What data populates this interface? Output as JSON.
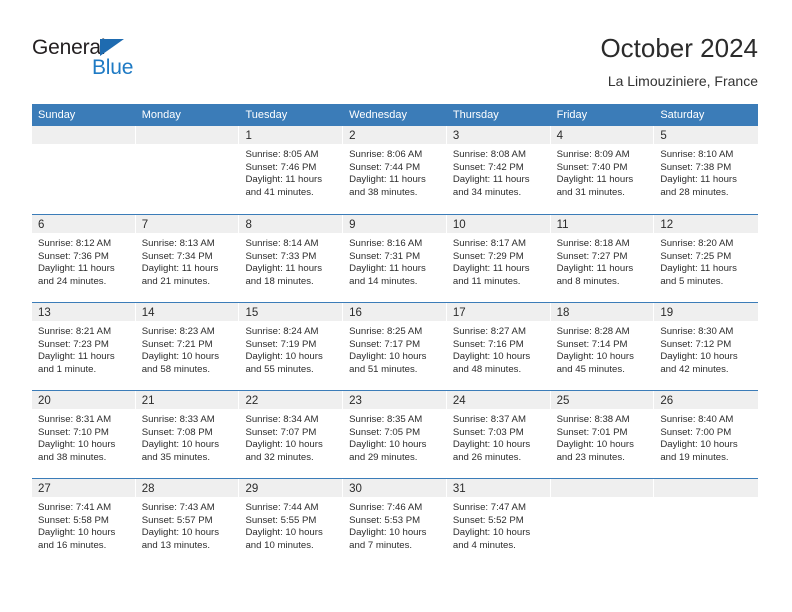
{
  "brand": {
    "name_part1": "General",
    "name_part2": "Blue",
    "color_dark": "#231f20",
    "color_blue": "#1e7ac4"
  },
  "header": {
    "title": "October 2024",
    "subtitle": "La Limouziniere, France"
  },
  "theme": {
    "header_blue": "#3b7cb8",
    "day_band_gray": "#efefef",
    "text": "#2d2d2d"
  },
  "weekday_headers": [
    "Sunday",
    "Monday",
    "Tuesday",
    "Wednesday",
    "Thursday",
    "Friday",
    "Saturday"
  ],
  "weeks": [
    {
      "days": [
        {
          "date": "",
          "sunrise": "",
          "sunset": "",
          "daylight1": "",
          "daylight2": ""
        },
        {
          "date": "",
          "sunrise": "",
          "sunset": "",
          "daylight1": "",
          "daylight2": ""
        },
        {
          "date": "1",
          "sunrise": "Sunrise: 8:05 AM",
          "sunset": "Sunset: 7:46 PM",
          "daylight1": "Daylight: 11 hours",
          "daylight2": "and 41 minutes."
        },
        {
          "date": "2",
          "sunrise": "Sunrise: 8:06 AM",
          "sunset": "Sunset: 7:44 PM",
          "daylight1": "Daylight: 11 hours",
          "daylight2": "and 38 minutes."
        },
        {
          "date": "3",
          "sunrise": "Sunrise: 8:08 AM",
          "sunset": "Sunset: 7:42 PM",
          "daylight1": "Daylight: 11 hours",
          "daylight2": "and 34 minutes."
        },
        {
          "date": "4",
          "sunrise": "Sunrise: 8:09 AM",
          "sunset": "Sunset: 7:40 PM",
          "daylight1": "Daylight: 11 hours",
          "daylight2": "and 31 minutes."
        },
        {
          "date": "5",
          "sunrise": "Sunrise: 8:10 AM",
          "sunset": "Sunset: 7:38 PM",
          "daylight1": "Daylight: 11 hours",
          "daylight2": "and 28 minutes."
        }
      ]
    },
    {
      "days": [
        {
          "date": "6",
          "sunrise": "Sunrise: 8:12 AM",
          "sunset": "Sunset: 7:36 PM",
          "daylight1": "Daylight: 11 hours",
          "daylight2": "and 24 minutes."
        },
        {
          "date": "7",
          "sunrise": "Sunrise: 8:13 AM",
          "sunset": "Sunset: 7:34 PM",
          "daylight1": "Daylight: 11 hours",
          "daylight2": "and 21 minutes."
        },
        {
          "date": "8",
          "sunrise": "Sunrise: 8:14 AM",
          "sunset": "Sunset: 7:33 PM",
          "daylight1": "Daylight: 11 hours",
          "daylight2": "and 18 minutes."
        },
        {
          "date": "9",
          "sunrise": "Sunrise: 8:16 AM",
          "sunset": "Sunset: 7:31 PM",
          "daylight1": "Daylight: 11 hours",
          "daylight2": "and 14 minutes."
        },
        {
          "date": "10",
          "sunrise": "Sunrise: 8:17 AM",
          "sunset": "Sunset: 7:29 PM",
          "daylight1": "Daylight: 11 hours",
          "daylight2": "and 11 minutes."
        },
        {
          "date": "11",
          "sunrise": "Sunrise: 8:18 AM",
          "sunset": "Sunset: 7:27 PM",
          "daylight1": "Daylight: 11 hours",
          "daylight2": "and 8 minutes."
        },
        {
          "date": "12",
          "sunrise": "Sunrise: 8:20 AM",
          "sunset": "Sunset: 7:25 PM",
          "daylight1": "Daylight: 11 hours",
          "daylight2": "and 5 minutes."
        }
      ]
    },
    {
      "days": [
        {
          "date": "13",
          "sunrise": "Sunrise: 8:21 AM",
          "sunset": "Sunset: 7:23 PM",
          "daylight1": "Daylight: 11 hours",
          "daylight2": "and 1 minute."
        },
        {
          "date": "14",
          "sunrise": "Sunrise: 8:23 AM",
          "sunset": "Sunset: 7:21 PM",
          "daylight1": "Daylight: 10 hours",
          "daylight2": "and 58 minutes."
        },
        {
          "date": "15",
          "sunrise": "Sunrise: 8:24 AM",
          "sunset": "Sunset: 7:19 PM",
          "daylight1": "Daylight: 10 hours",
          "daylight2": "and 55 minutes."
        },
        {
          "date": "16",
          "sunrise": "Sunrise: 8:25 AM",
          "sunset": "Sunset: 7:17 PM",
          "daylight1": "Daylight: 10 hours",
          "daylight2": "and 51 minutes."
        },
        {
          "date": "17",
          "sunrise": "Sunrise: 8:27 AM",
          "sunset": "Sunset: 7:16 PM",
          "daylight1": "Daylight: 10 hours",
          "daylight2": "and 48 minutes."
        },
        {
          "date": "18",
          "sunrise": "Sunrise: 8:28 AM",
          "sunset": "Sunset: 7:14 PM",
          "daylight1": "Daylight: 10 hours",
          "daylight2": "and 45 minutes."
        },
        {
          "date": "19",
          "sunrise": "Sunrise: 8:30 AM",
          "sunset": "Sunset: 7:12 PM",
          "daylight1": "Daylight: 10 hours",
          "daylight2": "and 42 minutes."
        }
      ]
    },
    {
      "days": [
        {
          "date": "20",
          "sunrise": "Sunrise: 8:31 AM",
          "sunset": "Sunset: 7:10 PM",
          "daylight1": "Daylight: 10 hours",
          "daylight2": "and 38 minutes."
        },
        {
          "date": "21",
          "sunrise": "Sunrise: 8:33 AM",
          "sunset": "Sunset: 7:08 PM",
          "daylight1": "Daylight: 10 hours",
          "daylight2": "and 35 minutes."
        },
        {
          "date": "22",
          "sunrise": "Sunrise: 8:34 AM",
          "sunset": "Sunset: 7:07 PM",
          "daylight1": "Daylight: 10 hours",
          "daylight2": "and 32 minutes."
        },
        {
          "date": "23",
          "sunrise": "Sunrise: 8:35 AM",
          "sunset": "Sunset: 7:05 PM",
          "daylight1": "Daylight: 10 hours",
          "daylight2": "and 29 minutes."
        },
        {
          "date": "24",
          "sunrise": "Sunrise: 8:37 AM",
          "sunset": "Sunset: 7:03 PM",
          "daylight1": "Daylight: 10 hours",
          "daylight2": "and 26 minutes."
        },
        {
          "date": "25",
          "sunrise": "Sunrise: 8:38 AM",
          "sunset": "Sunset: 7:01 PM",
          "daylight1": "Daylight: 10 hours",
          "daylight2": "and 23 minutes."
        },
        {
          "date": "26",
          "sunrise": "Sunrise: 8:40 AM",
          "sunset": "Sunset: 7:00 PM",
          "daylight1": "Daylight: 10 hours",
          "daylight2": "and 19 minutes."
        }
      ]
    },
    {
      "days": [
        {
          "date": "27",
          "sunrise": "Sunrise: 7:41 AM",
          "sunset": "Sunset: 5:58 PM",
          "daylight1": "Daylight: 10 hours",
          "daylight2": "and 16 minutes."
        },
        {
          "date": "28",
          "sunrise": "Sunrise: 7:43 AM",
          "sunset": "Sunset: 5:57 PM",
          "daylight1": "Daylight: 10 hours",
          "daylight2": "and 13 minutes."
        },
        {
          "date": "29",
          "sunrise": "Sunrise: 7:44 AM",
          "sunset": "Sunset: 5:55 PM",
          "daylight1": "Daylight: 10 hours",
          "daylight2": "and 10 minutes."
        },
        {
          "date": "30",
          "sunrise": "Sunrise: 7:46 AM",
          "sunset": "Sunset: 5:53 PM",
          "daylight1": "Daylight: 10 hours",
          "daylight2": "and 7 minutes."
        },
        {
          "date": "31",
          "sunrise": "Sunrise: 7:47 AM",
          "sunset": "Sunset: 5:52 PM",
          "daylight1": "Daylight: 10 hours",
          "daylight2": "and 4 minutes."
        },
        {
          "date": "",
          "sunrise": "",
          "sunset": "",
          "daylight1": "",
          "daylight2": ""
        },
        {
          "date": "",
          "sunrise": "",
          "sunset": "",
          "daylight1": "",
          "daylight2": ""
        }
      ]
    }
  ]
}
